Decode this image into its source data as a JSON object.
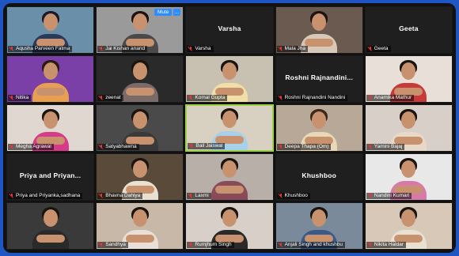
{
  "controls": {
    "mute_label": "Mute",
    "more_label": "..."
  },
  "tiles": [
    {
      "name": "Aqusha Parveen Fatma",
      "type": "video",
      "bg": "#6a8fa8",
      "shirt": "#2b3a5a",
      "hair": "#1a1a2a"
    },
    {
      "name": "Jai Kishan anand",
      "type": "video",
      "bg": "#9a9a9a",
      "shirt": "#4a4a4a",
      "hair": "#1a1410"
    },
    {
      "name": "Varsha",
      "type": "name",
      "center": "Varsha"
    },
    {
      "name": "Mala Jha",
      "type": "video",
      "bg": "#6a5a50",
      "shirt": "#d8c8b8",
      "hair": "#1a1410"
    },
    {
      "name": "Geeta",
      "type": "name",
      "center": "Geeta"
    },
    {
      "name": "Nitika",
      "type": "video",
      "bg": "#7b3fa8",
      "shirt": "#e8a050",
      "hair": "#2a1a12"
    },
    {
      "name": "zeenat",
      "type": "video",
      "bg": "#2a2a2a",
      "shirt": "#7a6a6a",
      "hair": "#1a1410"
    },
    {
      "name": "Komal Gupta",
      "type": "video",
      "bg": "#c8c0b0",
      "shirt": "#f0e0a8",
      "hair": "#1a1410"
    },
    {
      "name": "Roshni Rajnandini Nandini",
      "type": "name",
      "center": "Roshni Rajnandini..."
    },
    {
      "name": "Anamika Mathur",
      "type": "video",
      "bg": "#e8e0d8",
      "shirt": "#c83a3a",
      "hair": "#1a1410"
    },
    {
      "name": "Megha Agrawal",
      "type": "video",
      "bg": "#e0d8d0",
      "shirt": "#d83a8a",
      "hair": "#1a1410"
    },
    {
      "name": "Satyabhawna",
      "type": "video",
      "bg": "#4a4a4a",
      "shirt": "#3a3a3a",
      "hair": "#1a1410"
    },
    {
      "name": "Bail Jaiswal",
      "type": "video",
      "active": true,
      "bg": "#d8d0c0",
      "shirt": "#a8d0e8",
      "hair": "#1a1410"
    },
    {
      "name": "Deepa Thapa (Om)",
      "type": "video",
      "bg": "#b8a898",
      "shirt": "#e8d8b8",
      "hair": "#3a2a1a"
    },
    {
      "name": "Yamini Bajaj",
      "type": "video",
      "bg": "#d8d0c8",
      "shirt": "#e8d8c8",
      "hair": "#1a1410"
    },
    {
      "name": "Priya and Priyanka,sadhana",
      "type": "name",
      "center": "Priya and Priyan..."
    },
    {
      "name": "Bhavna Dahiya",
      "type": "video",
      "bg": "#5a4a3a",
      "shirt": "#e8e0d0",
      "hair": "#1a1410"
    },
    {
      "name": "Laxmi",
      "type": "video",
      "bg": "#b8b0a8",
      "shirt": "#8a4a5a",
      "hair": "#1a1410"
    },
    {
      "name": "Khushboo",
      "type": "name",
      "center": "Khushboo"
    },
    {
      "name": "Nandini Kumari",
      "type": "video",
      "bg": "#e8e8e8",
      "shirt": "#d87aa8",
      "hair": "#1a1410"
    },
    {
      "name": "",
      "type": "video",
      "bg": "#3a3a3a",
      "shirt": "#2a2a2a",
      "hair": "#1a1410"
    },
    {
      "name": "Sandhya",
      "type": "video",
      "bg": "#c8b8a8",
      "shirt": "#e8e0d8",
      "hair": "#1a1410"
    },
    {
      "name": "Rumjhum Singh",
      "type": "video",
      "bg": "#d8d0c8",
      "shirt": "#2a2a2a",
      "hair": "#1a1410"
    },
    {
      "name": "Anjali Singh and khushbu",
      "type": "video",
      "bg": "#7a8a9a",
      "shirt": "#3a5a8a",
      "hair": "#1a1410"
    },
    {
      "name": "Nikita Haldar",
      "type": "video",
      "bg": "#d8c8b8",
      "shirt": "#e8e0d0",
      "hair": "#1a1410"
    }
  ]
}
